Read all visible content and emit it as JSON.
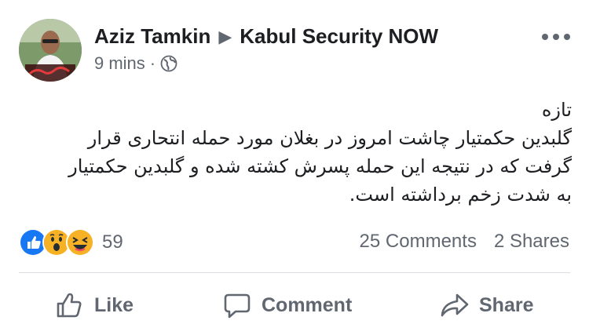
{
  "post": {
    "author": "Aziz Tamkin",
    "group": "Kabul Security NOW",
    "time": "9 mins",
    "separator": "·",
    "privacy_icon": "globe-icon",
    "text_lines": [
      "تازه",
      "گلبدین حکمتیار چاشت امروز در بغلان مورد حمله انتحاری قرار",
      "گرفت که در نتیجه این حمله پسرش کشته شده و گلبدین حکمتیار",
      "به شدت زخم برداشته است."
    ]
  },
  "reactions": {
    "icons": [
      "like-reaction-icon",
      "wow-reaction-icon",
      "haha-reaction-icon"
    ],
    "count": "59",
    "comments": "25 Comments",
    "shares": "2 Shares"
  },
  "actions": {
    "like": "Like",
    "comment": "Comment",
    "share": "Share"
  },
  "colors": {
    "text": "#1c1e21",
    "secondary": "#606770",
    "like_blue": "#1877f2",
    "reaction_yellow": "#f7b125",
    "divider": "#dadde1"
  }
}
